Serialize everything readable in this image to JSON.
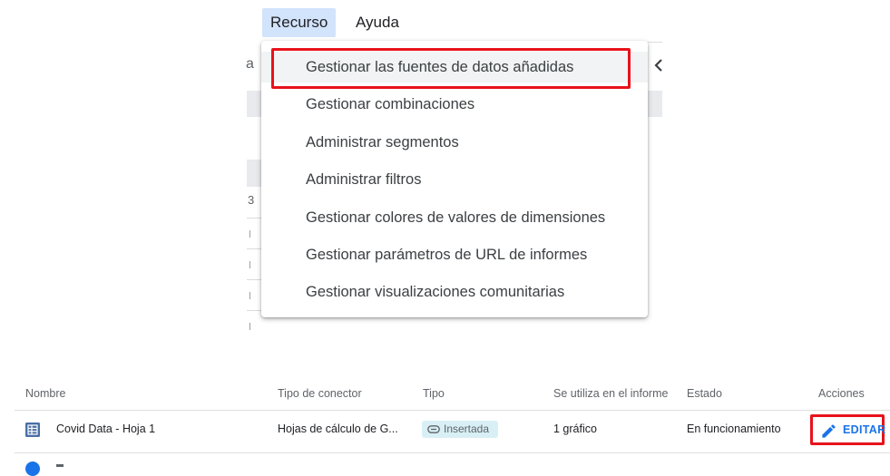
{
  "menubar": {
    "items": [
      "Recurso",
      "Ayuda"
    ]
  },
  "background": {
    "fragments": [
      "a",
      "3"
    ]
  },
  "menu": {
    "items": [
      "Gestionar las fuentes de datos añadidas",
      "Gestionar combinaciones",
      "Administrar segmentos",
      "Administrar filtros",
      "Gestionar colores de valores de dimensiones",
      "Gestionar parámetros de URL de informes",
      "Gestionar visualizaciones comunitarias"
    ]
  },
  "table": {
    "headers": {
      "nombre": "Nombre",
      "tipo_conector": "Tipo de conector",
      "tipo": "Tipo",
      "se_utiliza": "Se utiliza en el informe",
      "estado": "Estado",
      "acciones": "Acciones"
    },
    "rows": [
      {
        "nombre": "Covid Data - Hoja 1",
        "tipo_conector": "Hojas de cálculo de G...",
        "tipo": "Insertada",
        "se_utiliza": "1 gráfico",
        "estado": "En funcionamiento",
        "accion": "EDITAR"
      }
    ]
  },
  "colors": {
    "accent": "#1a73e8",
    "highlight": "#e8121b",
    "menu_active_bg": "#d2e3fc",
    "chip_bg": "#d8f0f5"
  },
  "icons": {
    "menu_collapse": "chevron-left-icon",
    "row_source": "sheet-table-icon",
    "chip": "link-icon",
    "edit": "pencil-icon",
    "next_row": "blue-circle-icon"
  }
}
